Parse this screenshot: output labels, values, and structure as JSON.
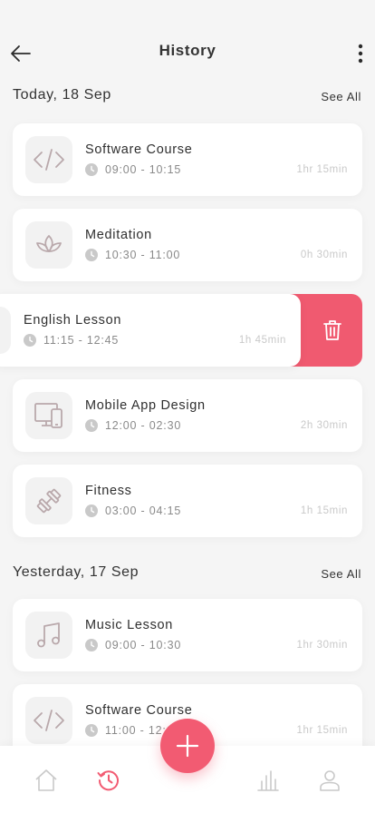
{
  "header": {
    "title": "History"
  },
  "sections": [
    {
      "title": "Today, 18 Sep",
      "see_all": "See All",
      "items": [
        {
          "title": "Software Course",
          "time": "09:00 - 10:15",
          "duration": "1hr 15min",
          "icon": "code-icon"
        },
        {
          "title": "Meditation",
          "time": "10:30 - 11:00",
          "duration": "0h 30min",
          "icon": "lotus-icon"
        },
        {
          "title": "English Lesson",
          "time": "11:15 - 12:45",
          "duration": "1h 45min",
          "icon": "book-icon"
        },
        {
          "title": "Mobile App Design",
          "time": "12:00 - 02:30",
          "duration": "2h 30min",
          "icon": "devices-icon"
        },
        {
          "title": "Fitness",
          "time": "03:00 - 04:15",
          "duration": "1h 15min",
          "icon": "dumbbell-icon"
        }
      ]
    },
    {
      "title": "Yesterday, 17 Sep",
      "see_all": "See All",
      "items": [
        {
          "title": "Music Lesson",
          "time": "09:00 - 10:30",
          "duration": "1hr 30min",
          "icon": "music-note-icon"
        },
        {
          "title": "Software Course",
          "time": "11:00 - 12:15",
          "duration": "1hr 15min",
          "icon": "code-icon"
        }
      ]
    }
  ],
  "colors": {
    "accent": "#f25b72",
    "delete": "#f05a70",
    "icon": "#b9a8ab"
  },
  "nav": [
    "home-icon",
    "history-icon",
    "add-icon",
    "stats-icon",
    "profile-icon"
  ]
}
